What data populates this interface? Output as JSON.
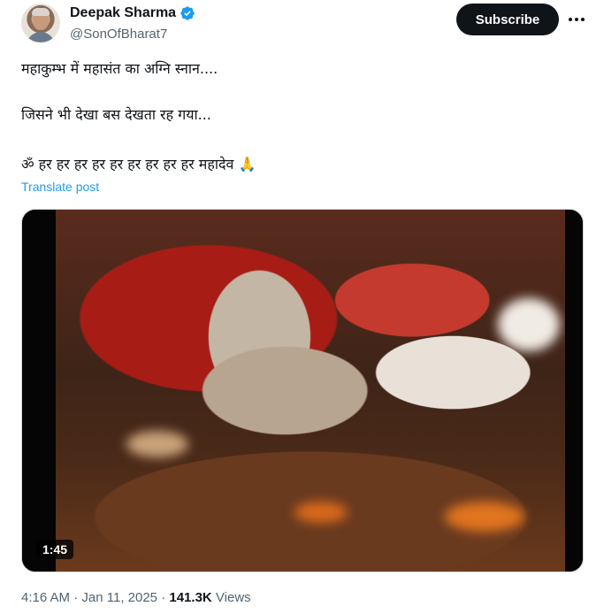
{
  "author": {
    "name": "Deepak Sharma",
    "handle": "@SonOfBharat7",
    "verified": true
  },
  "actions": {
    "subscribe_label": "Subscribe",
    "more_icon": "more-dots-icon"
  },
  "tweet": {
    "lines": [
      "महाकुम्भ में महासंत का अग्नि स्नान....",
      "जिसने भी देखा बस देखता रह गया...",
      "ॐ हर हर हर हर हर हर हर हर हर महादेव 🙏"
    ],
    "translate_label": "Translate post"
  },
  "media": {
    "duration": "1:45"
  },
  "meta": {
    "time": "4:16 AM",
    "separator1": " · ",
    "date": "Jan 11, 2025",
    "separator2": " · ",
    "views_count": "141.3K",
    "views_label": " Views"
  },
  "colors": {
    "accent": "#1d9bf0",
    "text": "#0f1419",
    "secondary": "#536471"
  }
}
